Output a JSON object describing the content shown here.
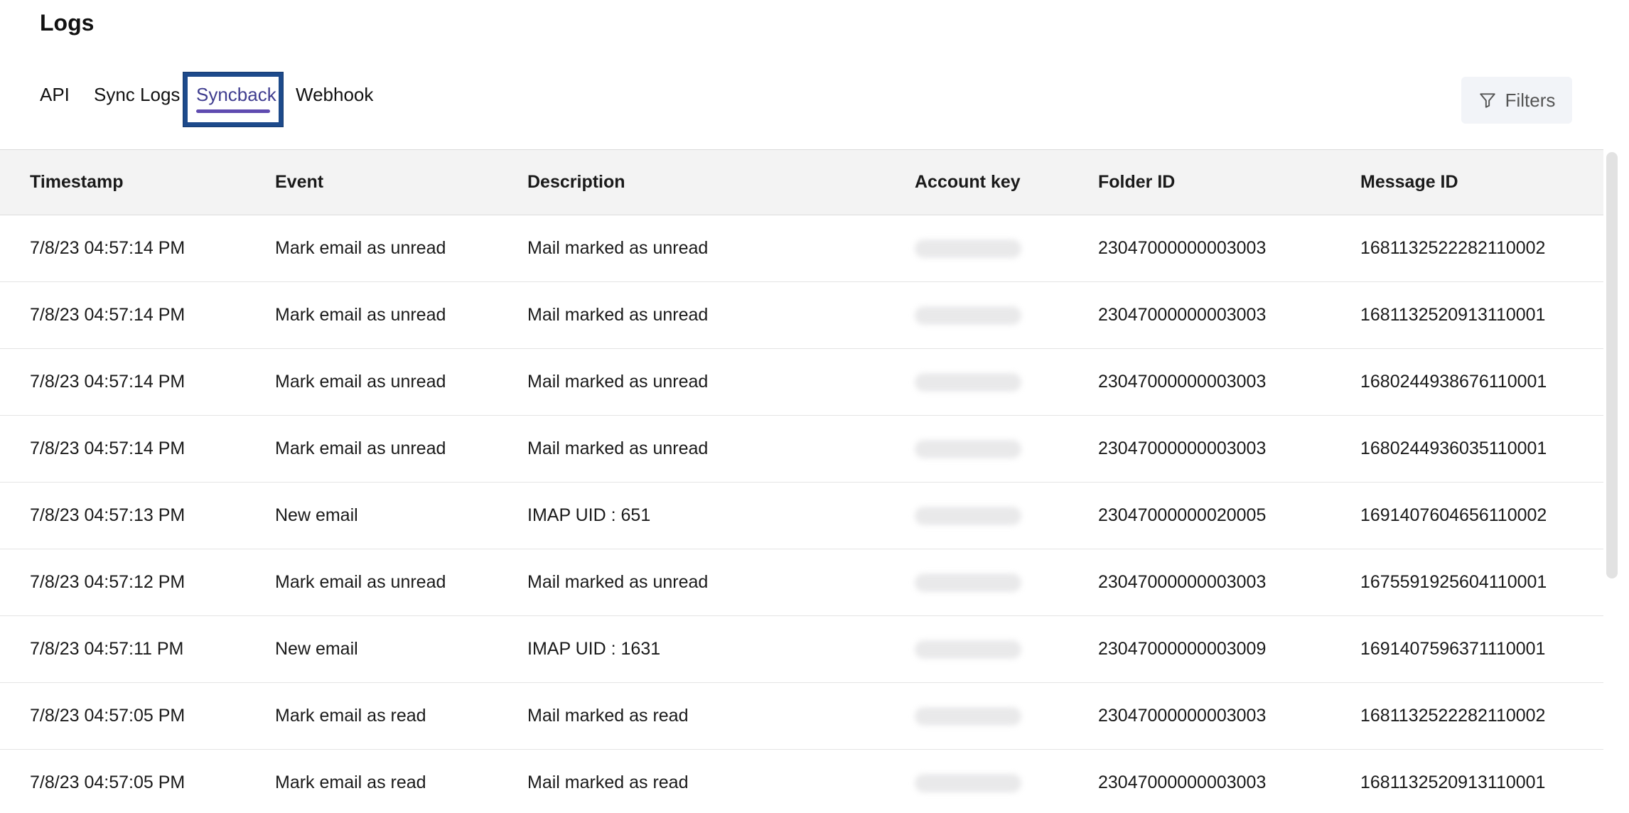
{
  "page": {
    "title": "Logs"
  },
  "tabs": [
    {
      "label": "API",
      "active": false
    },
    {
      "label": "Sync Logs",
      "active": false
    },
    {
      "label": "Syncback",
      "active": true
    },
    {
      "label": "Webhook",
      "active": false
    }
  ],
  "filters": {
    "label": "Filters",
    "icon": "filter-icon"
  },
  "colors": {
    "active_tab_text": "#3f3d8f",
    "active_tab_underline": "#5f4bb0",
    "highlight_border": "#1d4a8b",
    "header_bg": "#f3f3f3"
  },
  "table": {
    "columns": [
      "Timestamp",
      "Event",
      "Description",
      "Account key",
      "Folder ID",
      "Message ID"
    ],
    "rows": [
      {
        "timestamp": "7/8/23 04:57:14 PM",
        "event": "Mark email as unread",
        "description": "Mail marked as unread",
        "folder_id": "23047000000003003",
        "message_id": "1681132522282110002"
      },
      {
        "timestamp": "7/8/23 04:57:14 PM",
        "event": "Mark email as unread",
        "description": "Mail marked as unread",
        "folder_id": "23047000000003003",
        "message_id": "1681132520913110001"
      },
      {
        "timestamp": "7/8/23 04:57:14 PM",
        "event": "Mark email as unread",
        "description": "Mail marked as unread",
        "folder_id": "23047000000003003",
        "message_id": "1680244938676110001"
      },
      {
        "timestamp": "7/8/23 04:57:14 PM",
        "event": "Mark email as unread",
        "description": "Mail marked as unread",
        "folder_id": "23047000000003003",
        "message_id": "1680244936035110001"
      },
      {
        "timestamp": "7/8/23 04:57:13 PM",
        "event": "New email",
        "description": "IMAP UID : 651",
        "folder_id": "23047000000020005",
        "message_id": "1691407604656110002"
      },
      {
        "timestamp": "7/8/23 04:57:12 PM",
        "event": "Mark email as unread",
        "description": "Mail marked as unread",
        "folder_id": "23047000000003003",
        "message_id": "1675591925604110001"
      },
      {
        "timestamp": "7/8/23 04:57:11 PM",
        "event": "New email",
        "description": "IMAP UID : 1631",
        "folder_id": "23047000000003009",
        "message_id": "1691407596371110001"
      },
      {
        "timestamp": "7/8/23 04:57:05 PM",
        "event": "Mark email as read",
        "description": "Mail marked as read",
        "folder_id": "23047000000003003",
        "message_id": "1681132522282110002"
      },
      {
        "timestamp": "7/8/23 04:57:05 PM",
        "event": "Mark email as read",
        "description": "Mail marked as read",
        "folder_id": "23047000000003003",
        "message_id": "1681132520913110001"
      }
    ]
  }
}
